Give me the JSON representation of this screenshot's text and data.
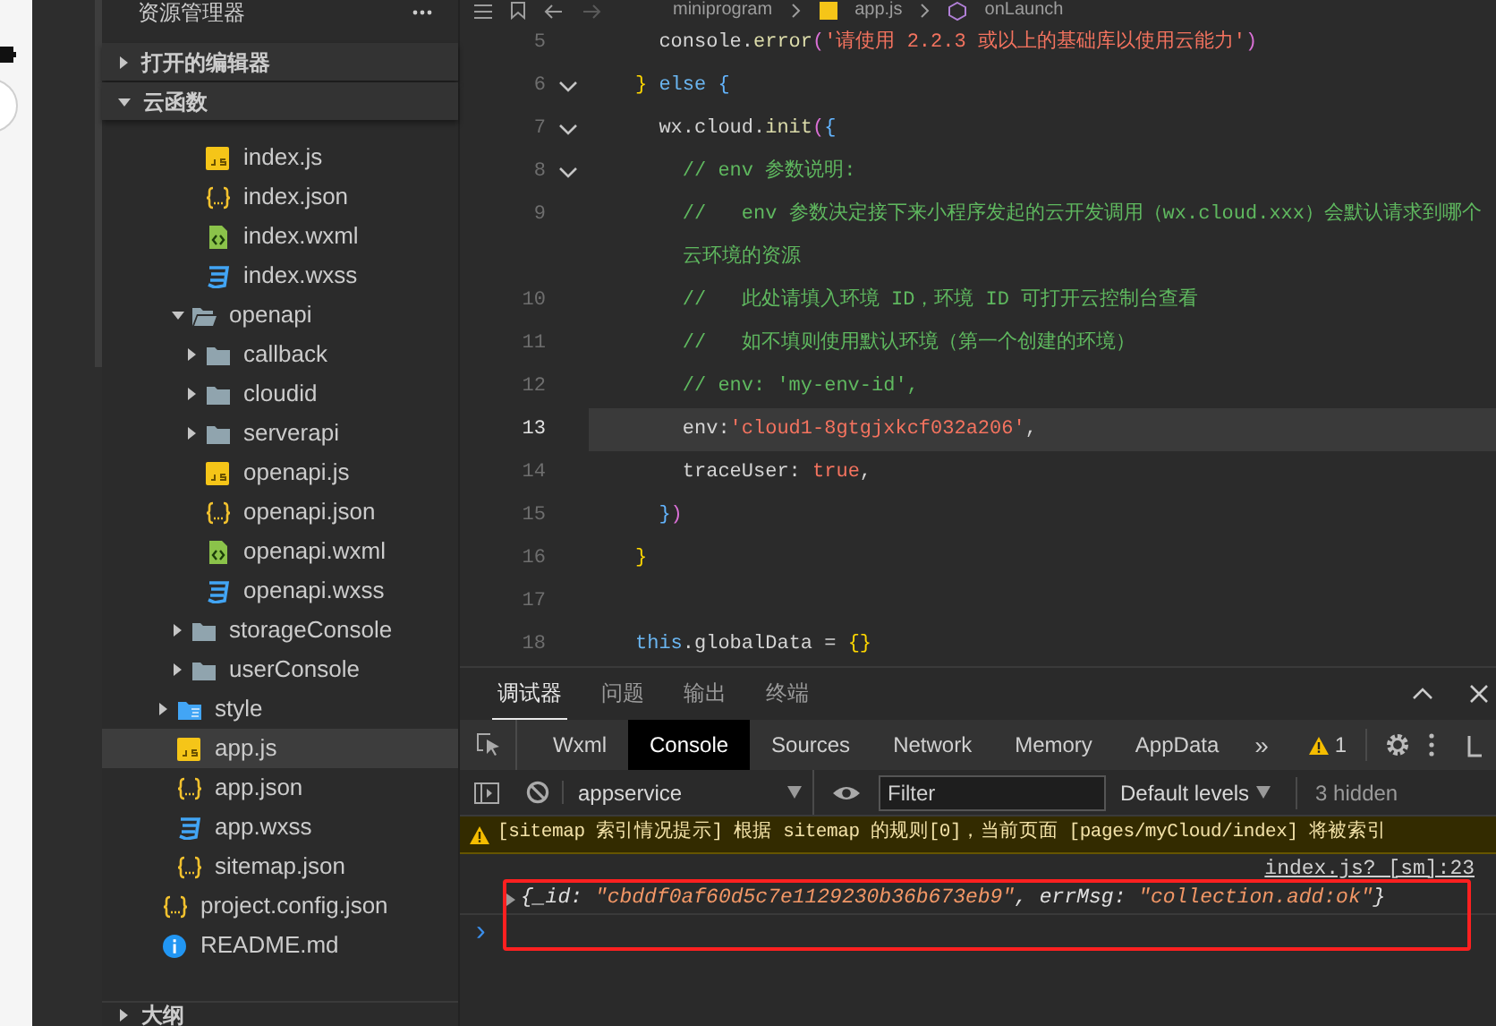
{
  "explorer": {
    "title": "资源管理器",
    "sections": [
      {
        "label": "打开的编辑器",
        "expanded": false
      },
      {
        "label": "云函数",
        "expanded": true
      }
    ],
    "tree": [
      {
        "children": [
          {
            "children": [
              {
                "children": [
                  {
                    "label": "index.js",
                    "kind": "js",
                    "selected": false
                  },
                  {
                    "label": "index.json",
                    "kind": "json",
                    "selected": false
                  },
                  {
                    "label": "index.wxml",
                    "kind": "wxml",
                    "selected": false
                  },
                  {
                    "label": "index.wxss",
                    "kind": "wxss",
                    "selected": false
                  }
                ]
              },
              {
                "label": "openapi",
                "kind": "folder",
                "expanded": true,
                "selected": false,
                "children": [
                  {
                    "label": "callback",
                    "kind": "folder",
                    "expanded": false,
                    "selected": false
                  },
                  {
                    "label": "cloudid",
                    "kind": "folder",
                    "expanded": false,
                    "selected": false
                  },
                  {
                    "label": "serverapi",
                    "kind": "folder",
                    "expanded": false,
                    "selected": false
                  },
                  {
                    "label": "openapi.js",
                    "kind": "js",
                    "selected": false
                  },
                  {
                    "label": "openapi.json",
                    "kind": "json",
                    "selected": false
                  },
                  {
                    "label": "openapi.wxml",
                    "kind": "wxml",
                    "selected": false
                  },
                  {
                    "label": "openapi.wxss",
                    "kind": "wxss",
                    "selected": false
                  }
                ]
              },
              {
                "label": "storageConsole",
                "kind": "folder",
                "expanded": false,
                "selected": false
              },
              {
                "label": "userConsole",
                "kind": "folder",
                "expanded": false,
                "selected": false
              }
            ]
          }
        ]
      },
      {
        "children": [
          {
            "label": "style",
            "kind": "stylefolder",
            "expanded": false,
            "selected": false
          },
          {
            "label": "app.js",
            "kind": "js",
            "selected": true
          },
          {
            "label": "app.json",
            "kind": "json",
            "selected": false
          },
          {
            "label": "app.wxss",
            "kind": "wxss",
            "selected": false
          },
          {
            "label": "sitemap.json",
            "kind": "json",
            "selected": false
          }
        ]
      },
      {
        "label": "project.config.json",
        "kind": "json",
        "selected": false
      },
      {
        "label": "README.md",
        "kind": "info",
        "selected": false
      }
    ],
    "outline": {
      "label": "大纲",
      "expanded": false
    }
  },
  "editor": {
    "breadcrumb": [
      "miniprogram",
      "app.js",
      "onLaunch"
    ],
    "lines": [
      {
        "number": "5",
        "foldable": false,
        "current": false,
        "tokens": [
          {
            "text": "  console.",
            "kind": "plain"
          },
          {
            "text": "error",
            "kind": "method"
          },
          {
            "text": "(",
            "kind": "bracket2"
          },
          {
            "text": "'请使用 2.2.3 或以上的基础库以使用云能力'",
            "kind": "string"
          },
          {
            "text": ")",
            "kind": "bracket2"
          }
        ]
      },
      {
        "number": "6",
        "foldable": true,
        "current": false,
        "tokens": [
          {
            "text": "}",
            "kind": "bracket1"
          },
          {
            "text": " else ",
            "kind": "keyword"
          },
          {
            "text": "{",
            "kind": "bracket3"
          }
        ]
      },
      {
        "number": "7",
        "foldable": true,
        "current": false,
        "tokens": [
          {
            "text": "  wx.cloud.",
            "kind": "plain"
          },
          {
            "text": "init",
            "kind": "method"
          },
          {
            "text": "(",
            "kind": "bracket2"
          },
          {
            "text": "{",
            "kind": "bracket3"
          }
        ]
      },
      {
        "number": "8",
        "foldable": true,
        "current": false,
        "tokens": [
          {
            "text": "    // env 参数说明:",
            "kind": "comment"
          }
        ]
      },
      {
        "number": "9",
        "foldable": false,
        "current": false,
        "tokens": [
          {
            "text": "    //   env 参数决定接下来小程序发起的云开发调用（wx.cloud.xxx）会默认请求到哪个云环境的资源",
            "kind": "comment"
          }
        ]
      },
      {
        "number": "10",
        "foldable": false,
        "current": false,
        "tokens": [
          {
            "text": "    //   此处请填入环境 ID，环境 ID 可打开云控制台查看",
            "kind": "comment"
          }
        ]
      },
      {
        "number": "11",
        "foldable": false,
        "current": false,
        "tokens": [
          {
            "text": "    //   如不填则使用默认环境（第一个创建的环境）",
            "kind": "comment"
          }
        ]
      },
      {
        "number": "12",
        "foldable": false,
        "current": false,
        "tokens": [
          {
            "text": "    // env: 'my-env-id',",
            "kind": "comment"
          }
        ]
      },
      {
        "number": "13",
        "foldable": false,
        "current": true,
        "tokens": [
          {
            "text": "    env:",
            "kind": "plain"
          },
          {
            "text": "'cloud1-8gtgjxkcf032a206'",
            "kind": "string"
          },
          {
            "text": ",",
            "kind": "plain"
          }
        ]
      },
      {
        "number": "14",
        "foldable": false,
        "current": false,
        "tokens": [
          {
            "text": "    traceUser: ",
            "kind": "plain"
          },
          {
            "text": "true",
            "kind": "string"
          },
          {
            "text": ",",
            "kind": "plain"
          }
        ]
      },
      {
        "number": "15",
        "foldable": false,
        "current": false,
        "tokens": [
          {
            "text": "  }",
            "kind": "bracket3"
          },
          {
            "text": ")",
            "kind": "bracket2"
          }
        ]
      },
      {
        "number": "16",
        "foldable": false,
        "current": false,
        "tokens": [
          {
            "text": "}",
            "kind": "bracket1"
          }
        ]
      },
      {
        "number": "17",
        "foldable": false,
        "current": false
      },
      {
        "number": "18",
        "foldable": false,
        "current": false,
        "tokens": [
          {
            "text": "this",
            "kind": "keyword"
          },
          {
            "text": ".globalData = ",
            "kind": "plain"
          },
          {
            "text": "{}",
            "kind": "bracket1"
          }
        ]
      }
    ]
  },
  "panel": {
    "tabs": [
      {
        "label": "调试器",
        "selected": true
      },
      {
        "label": "问题",
        "selected": false
      },
      {
        "label": "输出",
        "selected": false
      },
      {
        "label": "终端",
        "selected": false
      }
    ],
    "devtools_tabs": [
      {
        "label": "Wxml",
        "selected": false
      },
      {
        "label": "Console",
        "selected": true
      },
      {
        "label": "Sources",
        "selected": false
      },
      {
        "label": "Network",
        "selected": false
      },
      {
        "label": "Memory",
        "selected": false
      },
      {
        "label": "AppData",
        "selected": false
      }
    ],
    "more": "»",
    "warning_count": "1",
    "context": "appservice",
    "filter": {
      "placeholder": "Filter"
    },
    "levels": "Default levels",
    "hidden_count": "3 hidden",
    "messages": [
      {
        "kind": "warning",
        "text": "[sitemap 索引情况提示] 根据 sitemap 的规则[0]，当前页面 [pages/myCloud/index] 将被索引"
      },
      {
        "kind": "source",
        "text": "index.js? [sm]:23"
      },
      {
        "kind": "object",
        "tokens": [
          {
            "text": "{",
            "kind": "plain"
          },
          {
            "text": "_id",
            "kind": "key"
          },
          {
            "text": ": ",
            "kind": "plain"
          },
          {
            "text": "\"cbddf0af60d5c7e1129230b36b673eb9\"",
            "kind": "string"
          },
          {
            "text": ", ",
            "kind": "plain"
          },
          {
            "text": "errMsg",
            "kind": "key"
          },
          {
            "text": ": ",
            "kind": "plain"
          },
          {
            "text": "\"collection.add:ok\"",
            "kind": "string"
          },
          {
            "text": "}",
            "kind": "plain"
          }
        ]
      },
      {
        "kind": "prompt",
        "text": "›"
      }
    ]
  }
}
